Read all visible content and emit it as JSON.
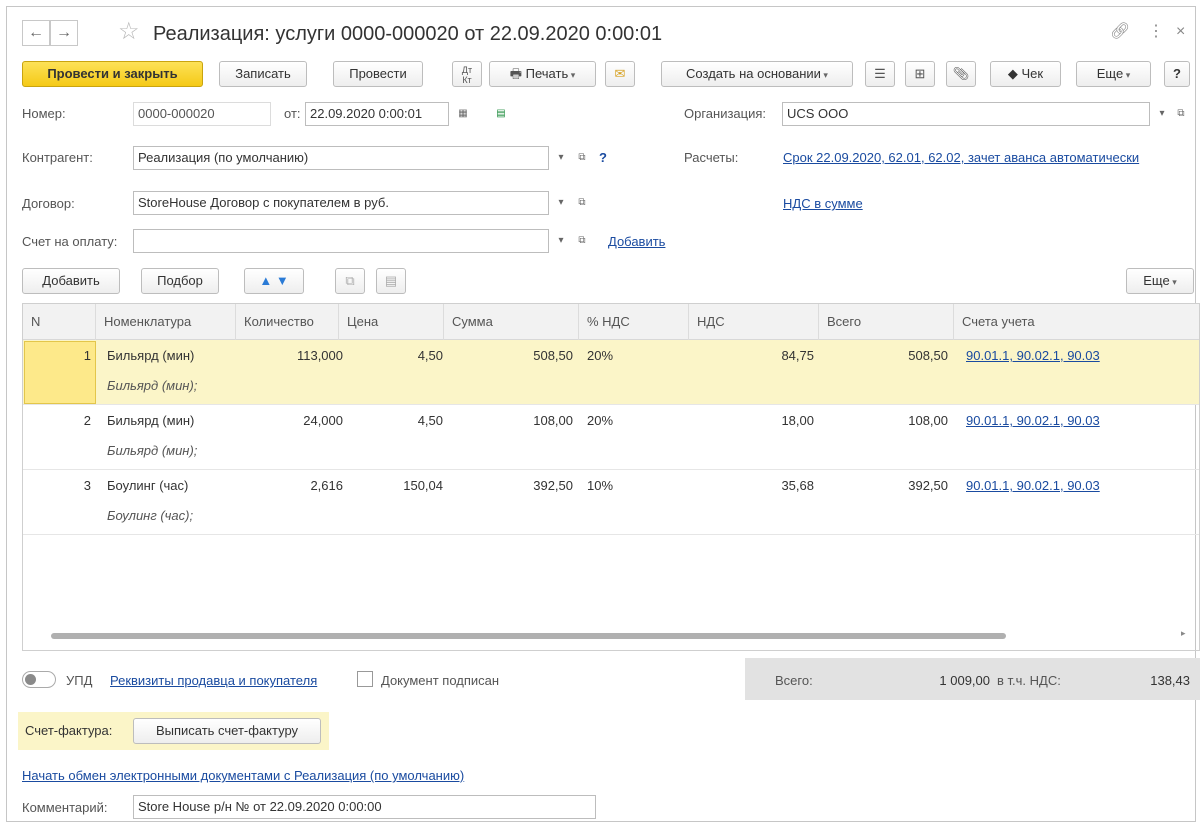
{
  "window": {
    "title": "Реализация: услуги 0000-000020 от 22.09.2020 0:00:01",
    "back_icon": "arrow-left",
    "forward_icon": "arrow-right",
    "favorite_icon": "star",
    "link_icon": "link",
    "menu_icon": "kebab",
    "close_icon": "close"
  },
  "toolbar": {
    "post_close": "Провести и закрыть",
    "save": "Записать",
    "post": "Провести",
    "dt_kt": "Дт Кт",
    "print": "Печать",
    "create_based": "Создать на основании",
    "receipt": "Чек",
    "more": "Еще",
    "help": "?"
  },
  "header": {
    "number_label": "Номер:",
    "number_value": "0000-000020",
    "date_label": "от:",
    "date_value": "22.09.2020  0:00:01",
    "org_label": "Организация:",
    "org_value": "UCS OOO",
    "contractor_label": "Контрагент:",
    "contractor_value": "Реализация (по умолчанию)",
    "help_q": "?",
    "settlements_label": "Расчеты:",
    "settlements_link": "Срок 22.09.2020, 62.01, 62.02, зачет аванса автоматически",
    "contract_label": "Договор:",
    "contract_value": "StoreHouse Договор с покупателем в руб.",
    "vat_link": "НДС в сумме",
    "invoice_label": "Счет на оплату:",
    "invoice_value": "",
    "add_link": "Добавить"
  },
  "table_toolbar": {
    "add": "Добавить",
    "select": "Подбор",
    "more": "Еще"
  },
  "table": {
    "columns": [
      "N",
      "Номенклатура",
      "Количество",
      "Цена",
      "Сумма",
      "% НДС",
      "НДС",
      "Всего",
      "Счета учета"
    ],
    "rows": [
      {
        "n": "1",
        "item": "Бильярд (мин)",
        "item_sub": "Бильярд (мин);",
        "qty": "113,000",
        "price": "4,50",
        "sum": "508,50",
        "vat_rate": "20%",
        "vat": "84,75",
        "total": "508,50",
        "accounts": "90.01.1, 90.02.1, 90.03"
      },
      {
        "n": "2",
        "item": "Бильярд (мин)",
        "item_sub": "Бильярд (мин);",
        "qty": "24,000",
        "price": "4,50",
        "sum": "108,00",
        "vat_rate": "20%",
        "vat": "18,00",
        "total": "108,00",
        "accounts": "90.01.1, 90.02.1, 90.03"
      },
      {
        "n": "3",
        "item": "Боулинг (час)",
        "item_sub": "Боулинг (час);",
        "qty": "2,616",
        "price": "150,04",
        "sum": "392,50",
        "vat_rate": "10%",
        "vat": "35,68",
        "total": "392,50",
        "accounts": "90.01.1, 90.02.1, 90.03"
      }
    ]
  },
  "footer": {
    "upd_label": "УПД",
    "requisites_link": "Реквизиты продавца и покупателя",
    "signed_label": "Документ подписан",
    "total_label": "Всего:",
    "total_value": "1 009,00",
    "vat_incl_label": "в т.ч. НДС:",
    "vat_value": "138,43",
    "sf_label": "Счет-фактура:",
    "sf_button": "Выписать счет-фактуру",
    "edo_link": "Начать обмен электронными документами с Реализация (по умолчанию)",
    "comment_label": "Комментарий:",
    "comment_value": "Store House р/н № от 22.09.2020 0:00:00"
  },
  "colors": {
    "primary": "#f5ca17",
    "selected_row": "#fbf5c8",
    "link": "#1a4ba0",
    "arrow_blue": "#2b7bd6"
  }
}
